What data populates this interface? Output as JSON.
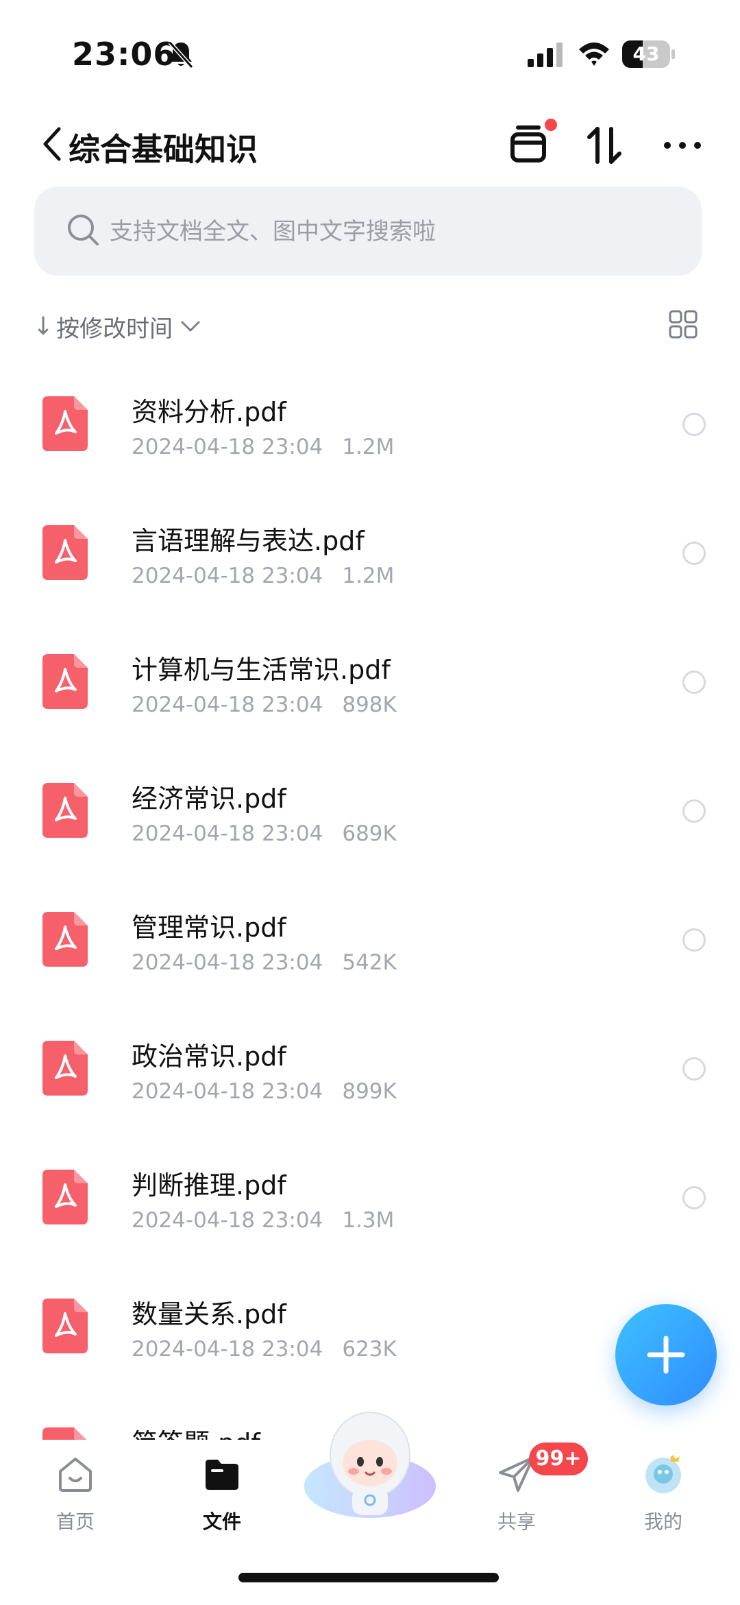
{
  "status_bar": {
    "time": "23:06",
    "battery": "43",
    "battery_level": 0.43
  },
  "header": {
    "title": "综合基础知识",
    "icons": {
      "back": "chevron-left-icon",
      "collection": "collection-box-icon",
      "sort": "sort-arrows-icon",
      "more": "more-dots-icon"
    },
    "notification_dot_color": "#f5464b"
  },
  "search": {
    "placeholder": "支持文档全文、图中文字搜索啦"
  },
  "sort_bar": {
    "arrow": "↓",
    "label": "按修改时间"
  },
  "files": [
    {
      "name": "资料分析.pdf",
      "date": "2024-04-18 23:04",
      "size": "1.2M"
    },
    {
      "name": "言语理解与表达.pdf",
      "date": "2024-04-18 23:04",
      "size": "1.2M"
    },
    {
      "name": "计算机与生活常识.pdf",
      "date": "2024-04-18 23:04",
      "size": "898K"
    },
    {
      "name": "经济常识.pdf",
      "date": "2024-04-18 23:04",
      "size": "689K"
    },
    {
      "name": "管理常识.pdf",
      "date": "2024-04-18 23:04",
      "size": "542K"
    },
    {
      "name": "政治常识.pdf",
      "date": "2024-04-18 23:04",
      "size": "899K"
    },
    {
      "name": "判断推理.pdf",
      "date": "2024-04-18 23:04",
      "size": "1.3M"
    },
    {
      "name": "数量关系.pdf",
      "date": "2024-04-18 23:04",
      "size": "623K"
    },
    {
      "name": "简答题.pdf",
      "date": "",
      "size": ""
    }
  ],
  "colors": {
    "pdf_icon": "#f5606a",
    "accent": "#2e8cff",
    "badge": "#f5464b"
  },
  "nav": {
    "home": "首页",
    "files": "文件",
    "share": "共享",
    "mine": "我的",
    "share_badge": "99+"
  }
}
